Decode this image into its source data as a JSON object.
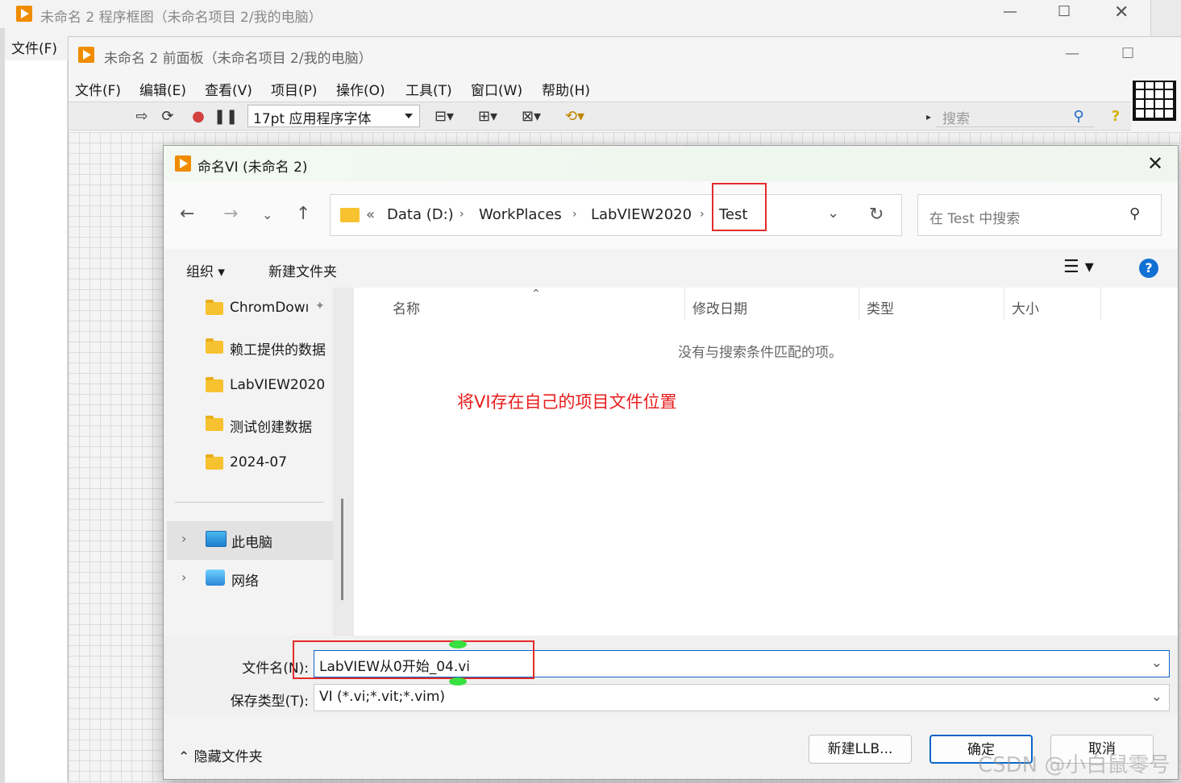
{
  "back_window": {
    "title": "未命名 2 程序框图（未命名项目 2/我的电脑）",
    "menu_file": "文件(F)"
  },
  "front_window": {
    "title": "未命名 2 前面板（未命名项目 2/我的电脑）",
    "menu": [
      "文件(F)",
      "编辑(E)",
      "查看(V)",
      "项目(P)",
      "操作(O)",
      "工具(T)",
      "窗口(W)",
      "帮助(H)"
    ],
    "font_select": "17pt 应用程序字体",
    "search_placeholder": "搜索"
  },
  "dialog": {
    "title": "命名VI (未命名 2)",
    "breadcrumb": {
      "prefix": "«",
      "items": [
        "Data (D:)",
        "WorkPlaces",
        "LabVIEW2020",
        "Test"
      ]
    },
    "search_placeholder": "在 Test 中搜索",
    "organize_label": "组织 ▾",
    "new_folder_label": "新建文件夹",
    "nav_items": [
      "ChromDowı",
      "赖工提供的数据",
      "LabVIEW2020",
      "测试创建数据",
      "2024-07"
    ],
    "this_pc_label": "此电脑",
    "network_label": "网络",
    "columns": [
      "名称",
      "修改日期",
      "类型",
      "大小"
    ],
    "empty_message": "没有与搜索条件匹配的项。",
    "annotation": "将VI存在自己的项目文件位置",
    "filename_label": "文件名(N):",
    "filename_value": "LabVIEW从0开始_04.vi",
    "filetype_label": "保存类型(T):",
    "filetype_value": "VI (*.vi;*.vit;*.vim)",
    "hide_folders_label": "隐藏文件夹",
    "btn_new_llb": "新建LLB...",
    "btn_ok": "确定",
    "btn_cancel": "取消",
    "watermark": "CSDN @小白鼠零号"
  },
  "colors": {
    "accent": "#0a64c8",
    "annotation_red": "#e32b2b",
    "labview_orange": "#f08c00"
  }
}
